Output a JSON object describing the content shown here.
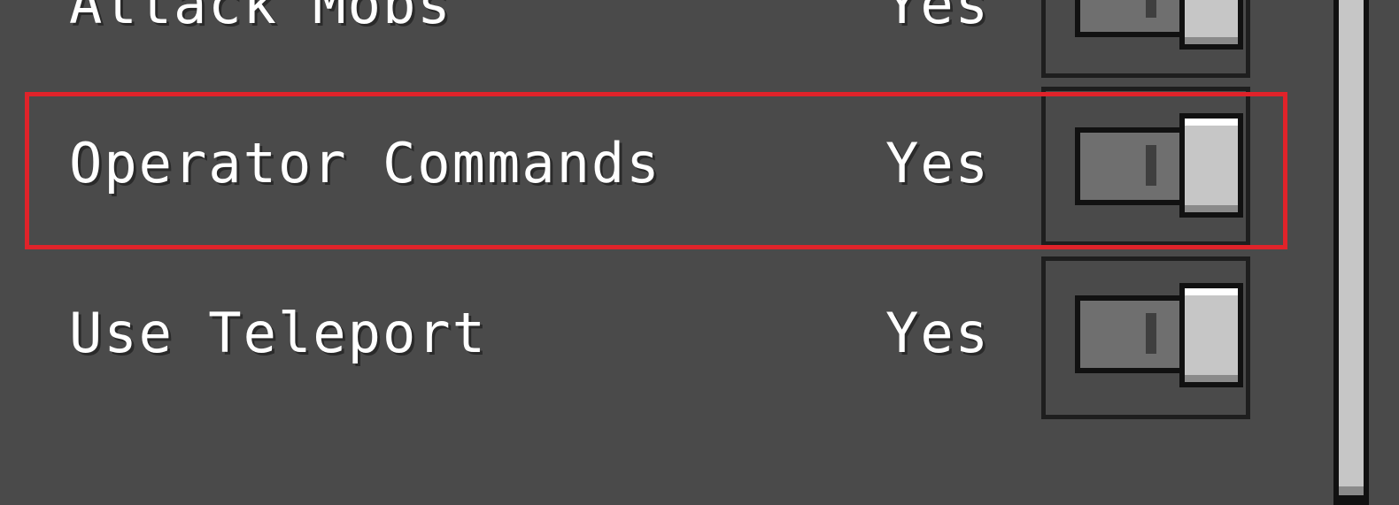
{
  "settings": {
    "rows": [
      {
        "label": "Attack Mobs",
        "value": "Yes",
        "enabled": true
      },
      {
        "label": "Operator Commands",
        "value": "Yes",
        "enabled": true
      },
      {
        "label": "Use Teleport",
        "value": "Yes",
        "enabled": true
      }
    ]
  },
  "highlight_color": "#e0232a",
  "background_color": "#4a4a4a"
}
